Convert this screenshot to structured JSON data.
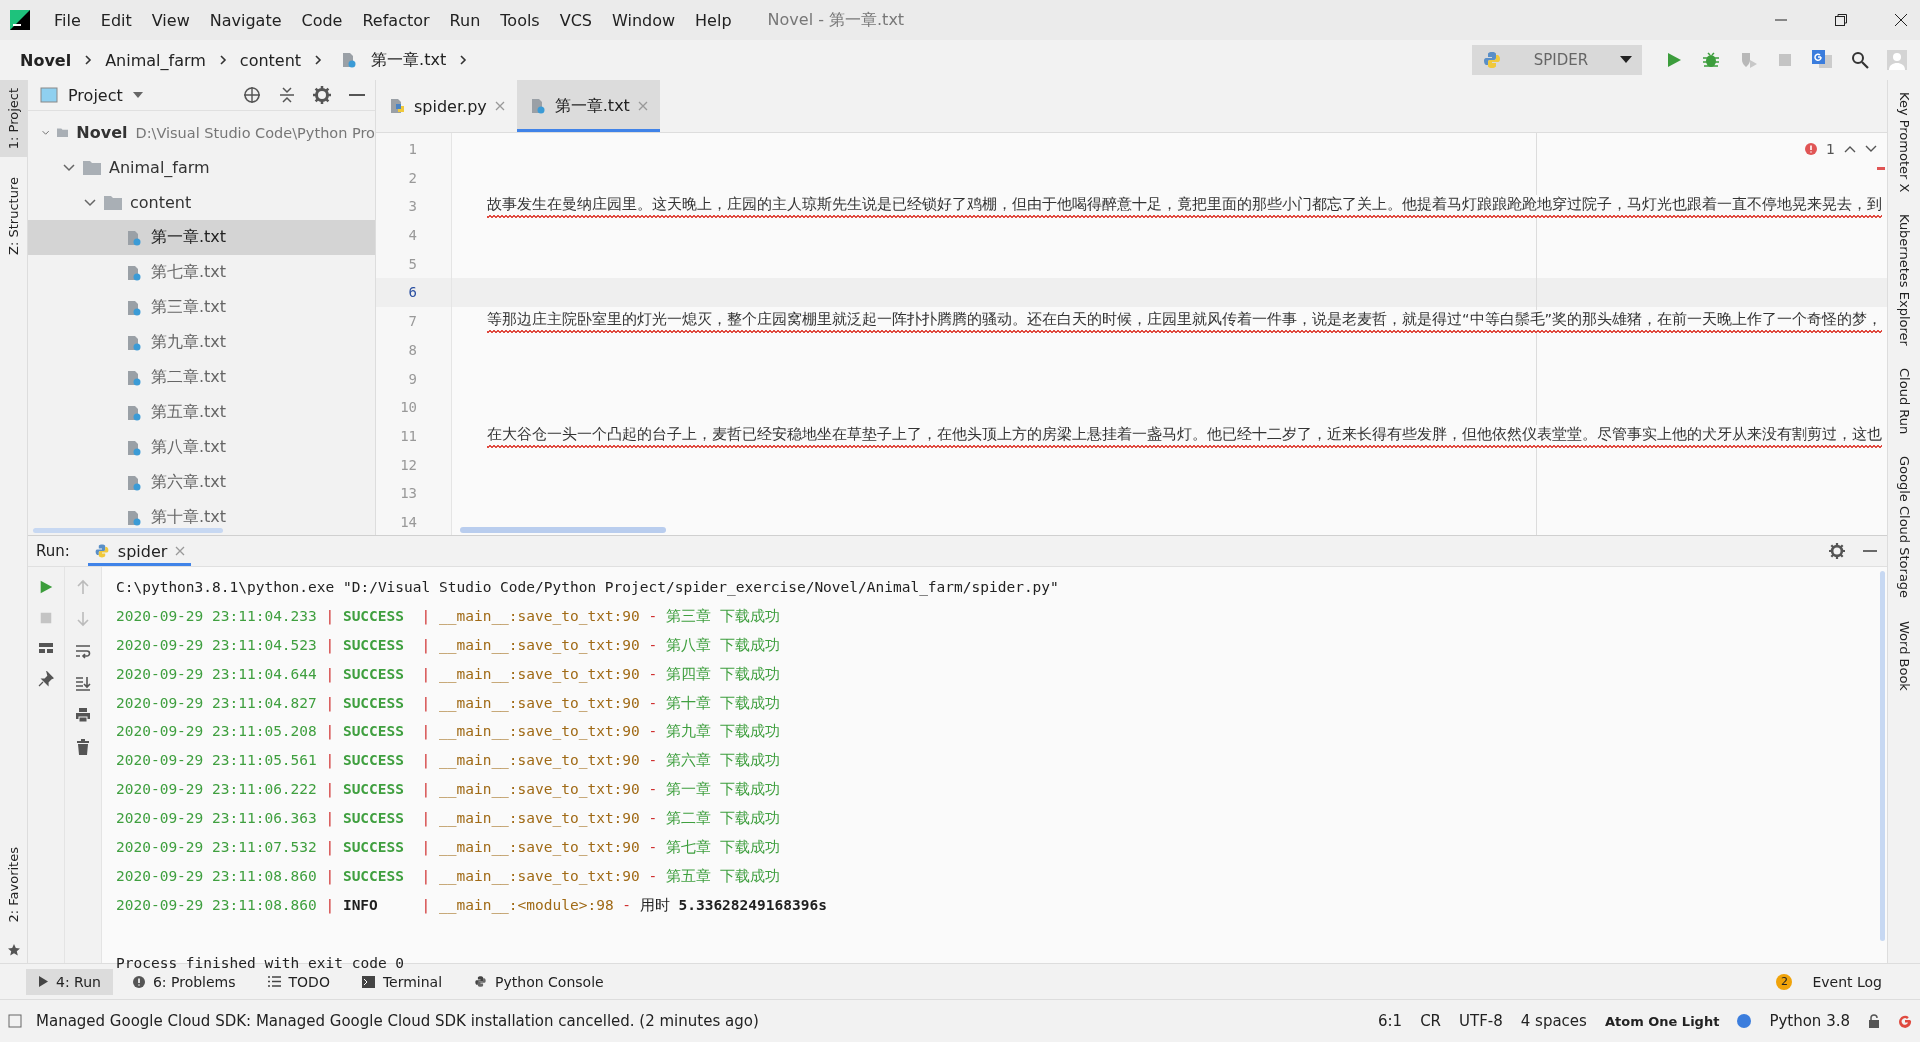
{
  "window": {
    "title": "Novel - 第一章.txt"
  },
  "menu": [
    "File",
    "Edit",
    "View",
    "Navigate",
    "Code",
    "Refactor",
    "Run",
    "Tools",
    "VCS",
    "Window",
    "Help"
  ],
  "breadcrumbs": [
    {
      "label": "Novel",
      "kind": "project"
    },
    {
      "label": "Animal_farm",
      "kind": "folder"
    },
    {
      "label": "content",
      "kind": "folder"
    },
    {
      "label": "第一章.txt",
      "kind": "file"
    }
  ],
  "toolbar": {
    "run_config": "SPIDER"
  },
  "left_strip": [
    {
      "label": "1: Project",
      "selected": true
    },
    {
      "label": "Z: Structure",
      "selected": false
    }
  ],
  "left_strip_bottom": [
    {
      "label": "2: Favorites",
      "selected": false
    }
  ],
  "right_strip": [
    "Key Promoter X",
    "Kubernetes Explorer",
    "Cloud Run",
    "Google Cloud Storage",
    "Word Book"
  ],
  "project": {
    "title": "Project",
    "tree": [
      {
        "label": "Novel",
        "path": "D:\\Visual Studio Code\\Python Pro",
        "kind": "folder",
        "expanded": true,
        "selected": false,
        "children": [
          {
            "label": "Animal_farm",
            "kind": "folder",
            "expanded": true,
            "selected": false,
            "children": [
              {
                "label": "content",
                "kind": "folder",
                "expanded": true,
                "selected": false,
                "children": [
                  {
                    "label": "第一章.txt",
                    "kind": "file",
                    "selected": true
                  },
                  {
                    "label": "第七章.txt",
                    "kind": "file",
                    "selected": false
                  },
                  {
                    "label": "第三章.txt",
                    "kind": "file",
                    "selected": false
                  },
                  {
                    "label": "第九章.txt",
                    "kind": "file",
                    "selected": false
                  },
                  {
                    "label": "第二章.txt",
                    "kind": "file",
                    "selected": false
                  },
                  {
                    "label": "第五章.txt",
                    "kind": "file",
                    "selected": false
                  },
                  {
                    "label": "第八章.txt",
                    "kind": "file",
                    "selected": false
                  },
                  {
                    "label": "第六章.txt",
                    "kind": "file",
                    "selected": false
                  },
                  {
                    "label": "第十章.txt",
                    "kind": "file",
                    "selected": false
                  }
                ]
              }
            ]
          }
        ]
      }
    ]
  },
  "editor": {
    "tabs": [
      {
        "label": "spider.py",
        "kind": "python",
        "selected": false
      },
      {
        "label": "第一章.txt",
        "kind": "text",
        "selected": true
      }
    ],
    "problems": "1",
    "lines": [
      {
        "number": "1",
        "current": false
      },
      {
        "number": "2",
        "current": false
      },
      {
        "number": "3",
        "text": "故事发生在曼纳庄园里。这天晚上，庄园的主人琼斯先生说是已经锁好了鸡棚，但由于他喝得醉意十足，竟把里面的那些小门都忘了关上。他提着马灯踉踉跄跄地穿过院子，马灯光也跟着一直不停地晃来晃去，到",
        "current": false,
        "flagged": true
      },
      {
        "number": "4",
        "current": false
      },
      {
        "number": "5",
        "current": false
      },
      {
        "number": "6",
        "current": true
      },
      {
        "number": "7",
        "text": "等那边庄主院卧室里的灯光一熄灭，整个庄园窝棚里就泛起一阵扑扑腾腾的骚动。还在白天的时候，庄园里就风传着一件事，说是老麦哲，就是得过“中等白鬃毛”奖的那头雄猪，在前一天晚上作了一个奇怪的梦，",
        "current": false,
        "flagged": true
      },
      {
        "number": "8",
        "current": false
      },
      {
        "number": "9",
        "current": false
      },
      {
        "number": "10",
        "current": false
      },
      {
        "number": "11",
        "text": "在大谷仓一头一个凸起的台子上，麦哲已经安稳地坐在草垫子上了，在他头顶上方的房梁上悬挂着一盏马灯。他已经十二岁了，近来长得有些发胖，但他依然仪表堂堂。尽管事实上他的犬牙从来没有割剪过，这也",
        "current": false,
        "flagged": true
      },
      {
        "number": "12",
        "current": false
      },
      {
        "number": "13",
        "current": false
      },
      {
        "number": "14",
        "current": false
      }
    ]
  },
  "run": {
    "label": "Run:",
    "tab": "spider",
    "command": "C:\\python3.8.1\\python.exe \"D:/Visual Studio Code/Python Project/spider_exercise/Novel/Animal_farm/spider.py\"",
    "log": [
      {
        "time": "2020-09-29 23:11:04.233",
        "separators": [
          "|",
          "|",
          "-"
        ],
        "level": "SUCCESS",
        "kind": "success",
        "source": "__main__:save_to_txt:90",
        "message": "第三章 下载成功"
      },
      {
        "time": "2020-09-29 23:11:04.523",
        "separators": [
          "|",
          "|",
          "-"
        ],
        "level": "SUCCESS",
        "kind": "success",
        "source": "__main__:save_to_txt:90",
        "message": "第八章 下载成功"
      },
      {
        "time": "2020-09-29 23:11:04.644",
        "separators": [
          "|",
          "|",
          "-"
        ],
        "level": "SUCCESS",
        "kind": "success",
        "source": "__main__:save_to_txt:90",
        "message": "第四章 下载成功"
      },
      {
        "time": "2020-09-29 23:11:04.827",
        "separators": [
          "|",
          "|",
          "-"
        ],
        "level": "SUCCESS",
        "kind": "success",
        "source": "__main__:save_to_txt:90",
        "message": "第十章 下载成功"
      },
      {
        "time": "2020-09-29 23:11:05.208",
        "separators": [
          "|",
          "|",
          "-"
        ],
        "level": "SUCCESS",
        "kind": "success",
        "source": "__main__:save_to_txt:90",
        "message": "第九章 下载成功"
      },
      {
        "time": "2020-09-29 23:11:05.561",
        "separators": [
          "|",
          "|",
          "-"
        ],
        "level": "SUCCESS",
        "kind": "success",
        "source": "__main__:save_to_txt:90",
        "message": "第六章 下载成功"
      },
      {
        "time": "2020-09-29 23:11:06.222",
        "separators": [
          "|",
          "|",
          "-"
        ],
        "level": "SUCCESS",
        "kind": "success",
        "source": "__main__:save_to_txt:90",
        "message": "第一章 下载成功"
      },
      {
        "time": "2020-09-29 23:11:06.363",
        "separators": [
          "|",
          "|",
          "-"
        ],
        "level": "SUCCESS",
        "kind": "success",
        "source": "__main__:save_to_txt:90",
        "message": "第二章 下载成功"
      },
      {
        "time": "2020-09-29 23:11:07.532",
        "separators": [
          "|",
          "|",
          "-"
        ],
        "level": "SUCCESS",
        "kind": "success",
        "source": "__main__:save_to_txt:90",
        "message": "第七章 下载成功"
      },
      {
        "time": "2020-09-29 23:11:08.860",
        "separators": [
          "|",
          "|",
          "-"
        ],
        "level": "SUCCESS",
        "kind": "success",
        "source": "__main__:save_to_txt:90",
        "message": "第五章 下载成功"
      },
      {
        "time": "2020-09-29 23:11:08.860",
        "separators": [
          "|",
          "|",
          "-"
        ],
        "level": "INFO",
        "kind": "info",
        "source": "__main__:<module>:98",
        "message": "用时 **5.33628249168396s**"
      }
    ],
    "exit": "Process finished with exit code 0"
  },
  "tool_tabs": [
    {
      "label": "4: Run",
      "kind": "run",
      "selected": true
    },
    {
      "label": "6: Problems",
      "kind": "problems",
      "selected": false
    },
    {
      "label": "TODO",
      "kind": "todo",
      "selected": false
    },
    {
      "label": "Terminal",
      "kind": "terminal",
      "selected": false
    },
    {
      "label": "Python Console",
      "kind": "python",
      "selected": false
    }
  ],
  "event_log": {
    "label": "Event Log",
    "count": "2"
  },
  "status_bar": {
    "message": "Managed Google Cloud SDK: Managed Google Cloud SDK installation cancelled. (2 minutes ago)",
    "items": [
      "6:1",
      "CR",
      "UTF-8",
      "4 spaces"
    ],
    "theme": "Atom One Light",
    "interpreter": "Python 3.8"
  }
}
